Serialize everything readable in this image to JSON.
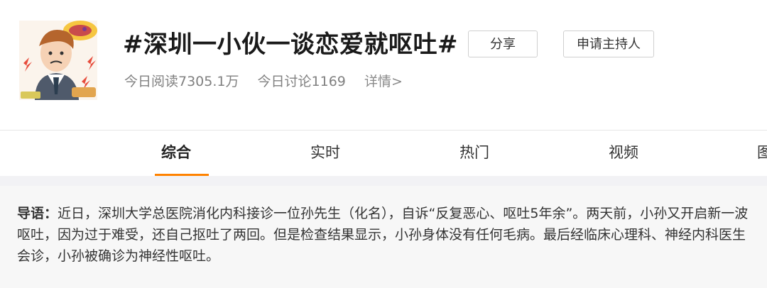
{
  "topic": {
    "title": "#深圳一小伙一谈恋爱就呕吐#",
    "read_today": "今日阅读7305.1万",
    "discuss_today": "今日讨论1169",
    "details_link": "详情>"
  },
  "actions": {
    "share": "分享",
    "apply_host": "申请主持人"
  },
  "tabs": [
    {
      "label": "综合",
      "active": true
    },
    {
      "label": "实时",
      "active": false
    },
    {
      "label": "热门",
      "active": false
    },
    {
      "label": "视频",
      "active": false
    },
    {
      "label": "图",
      "active": false
    }
  ],
  "intro": {
    "label": "导语：",
    "text": "近日，深圳大学总医院消化内科接诊一位孙先生（化名），自诉“反复恶心、呕吐5年余”。两天前，小孙又开启新一波呕吐，因为过于难受，还自己抠吐了两回。但是检查结果显示，小孙身体没有任何毛病。最后经临床心理科、神经内科医生会诊，小孙被确诊为神经性呕吐。"
  },
  "colors": {
    "accent": "#ff8200",
    "intro_bg": "#f7f7f7"
  }
}
